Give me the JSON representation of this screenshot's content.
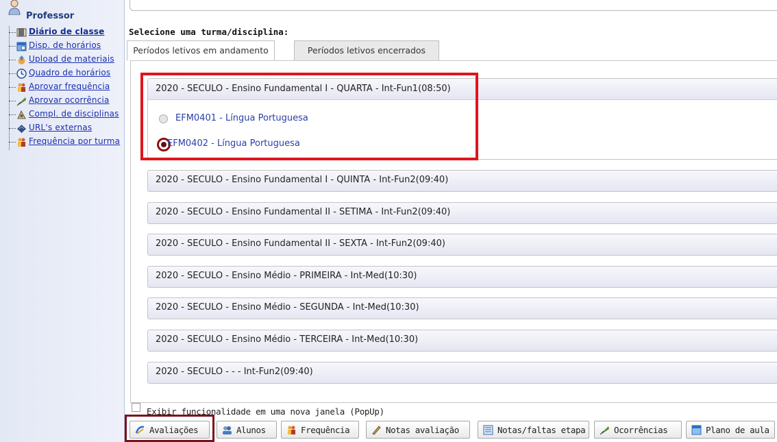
{
  "sidebar": {
    "title": "Professor",
    "items": [
      {
        "label": "Diário de classe",
        "icon": "book-icon",
        "active": true
      },
      {
        "label": "Disp. de horários",
        "icon": "calendar-icon"
      },
      {
        "label": "Upload de materiais",
        "icon": "upload-icon"
      },
      {
        "label": "Quadro de horários",
        "icon": "clock-icon"
      },
      {
        "label": "Aprovar frequência",
        "icon": "people-icon"
      },
      {
        "label": "Aprovar ocorrência",
        "icon": "quill-icon"
      },
      {
        "label": "Compl. de disciplinas",
        "icon": "disc-icon"
      },
      {
        "label": "URL's externas",
        "icon": "globe-icon"
      },
      {
        "label": "Frequência por turma",
        "icon": "people-icon"
      }
    ]
  },
  "main": {
    "select_label": "Selecione uma turma/disciplina:",
    "tabs": [
      {
        "label": "Períodos letivos em andamento",
        "active": true
      },
      {
        "label": "Períodos letivos encerrados",
        "active": false
      }
    ],
    "groups": [
      {
        "label": "2020 - SECULO  - Ensino Fundamental I - QUARTA - Int-Fun1(08:50)",
        "expanded": true,
        "options": [
          {
            "label": "EFM0401 - Língua Portuguesa",
            "checked": false
          },
          {
            "label": "EFM0402 - Língua Portuguesa",
            "checked": true
          }
        ]
      },
      {
        "label": "2020 - SECULO  - Ensino Fundamental I - QUINTA - Int-Fun2(09:40)"
      },
      {
        "label": "2020 - SECULO  - Ensino Fundamental II - SETIMA - Int-Fun2(09:40)"
      },
      {
        "label": "2020 - SECULO  - Ensino Fundamental II - SEXTA - Int-Fun2(09:40)"
      },
      {
        "label": "2020 - SECULO  - Ensino Médio - PRIMEIRA - Int-Med(10:30)"
      },
      {
        "label": "2020 - SECULO  - Ensino Médio - SEGUNDA - Int-Med(10:30)"
      },
      {
        "label": "2020 - SECULO  - Ensino Médio - TERCEIRA - Int-Med(10:30)"
      },
      {
        "label": "2020 - SECULO  -  -  - Int-Fun2(09:40)"
      }
    ]
  },
  "footer": {
    "popup_label": "Exibir funcionalidade em uma nova janela (PopUp)",
    "popup_checked": false,
    "buttons": [
      {
        "label": "Avaliações",
        "icon": "evaluation-icon"
      },
      {
        "label": "Alunos",
        "icon": "students-icon"
      },
      {
        "label": "Frequência",
        "icon": "people-icon"
      },
      {
        "label": "Notas avaliação",
        "icon": "pencil-icon"
      },
      {
        "label": "Notas/faltas etapa",
        "icon": "list-icon"
      },
      {
        "label": "Ocorrências",
        "icon": "quill-icon"
      },
      {
        "label": "Plano de aula",
        "icon": "plan-icon"
      }
    ]
  },
  "colors": {
    "highlight": "#e0141e",
    "button_highlight": "#7a0f1a",
    "link": "#1a2fb0",
    "radio_checked": "#8b1010"
  }
}
